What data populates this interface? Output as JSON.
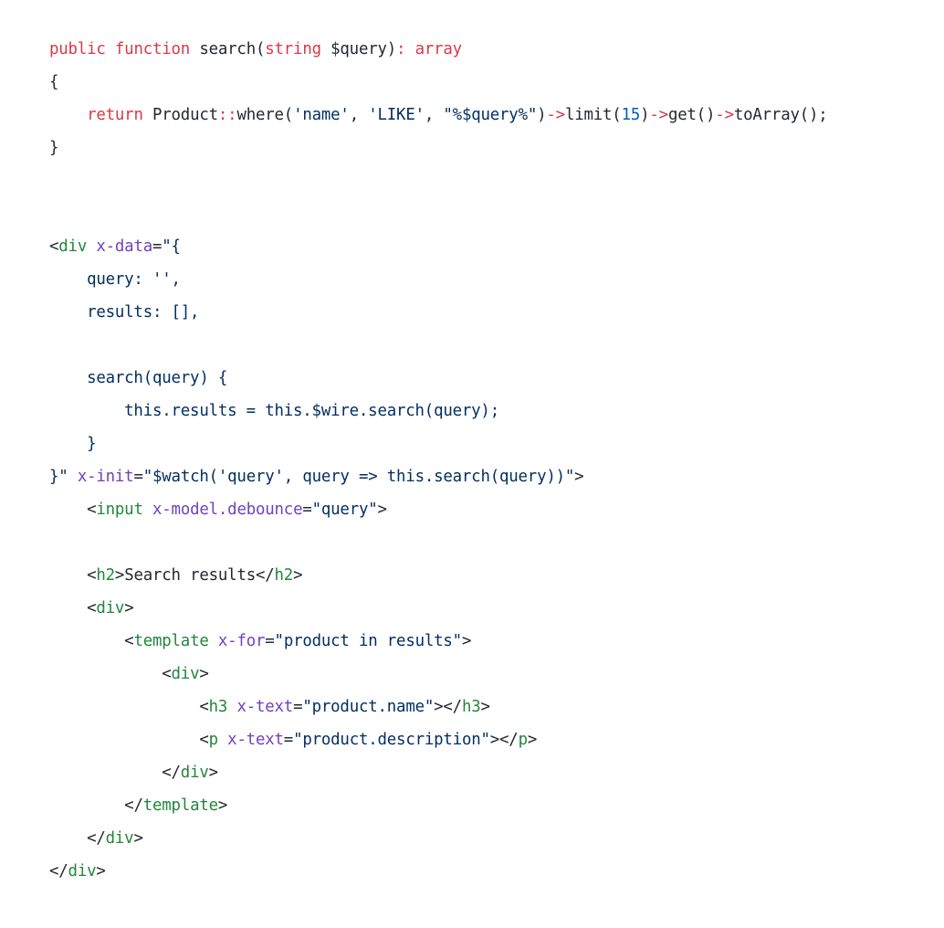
{
  "colors": {
    "background": "#ffffff",
    "keyword": "#d73a49",
    "plain": "#24292e",
    "string": "#032f62",
    "number": "#005cc5",
    "tag": "#22863a",
    "attribute": "#6f42c1"
  },
  "code": {
    "language_sections": [
      "php",
      "html-alpine"
    ],
    "lines": [
      [
        [
          "keyword",
          "public"
        ],
        [
          "plain",
          " "
        ],
        [
          "keyword",
          "function"
        ],
        [
          "plain",
          " search("
        ],
        [
          "keyword",
          "string"
        ],
        [
          "plain",
          " $query)"
        ],
        [
          "keyword",
          ": array"
        ]
      ],
      [
        [
          "plain",
          "{"
        ]
      ],
      [
        [
          "plain",
          "    "
        ],
        [
          "keyword",
          "return"
        ],
        [
          "plain",
          " Product"
        ],
        [
          "keyword",
          "::"
        ],
        [
          "plain",
          "where("
        ],
        [
          "string",
          "'name'"
        ],
        [
          "plain",
          ", "
        ],
        [
          "string",
          "'LIKE'"
        ],
        [
          "plain",
          ", "
        ],
        [
          "string",
          "\"%$query%\""
        ],
        [
          "plain",
          ")"
        ],
        [
          "keyword",
          "->"
        ],
        [
          "plain",
          "limit("
        ],
        [
          "number",
          "15"
        ],
        [
          "plain",
          ")"
        ],
        [
          "keyword",
          "->"
        ],
        [
          "plain",
          "get()"
        ],
        [
          "keyword",
          "->"
        ],
        [
          "plain",
          "toArray();"
        ]
      ],
      [
        [
          "plain",
          "}"
        ]
      ],
      [
        [
          "plain",
          ""
        ]
      ],
      [
        [
          "plain",
          ""
        ]
      ],
      [
        [
          "punct",
          "<"
        ],
        [
          "tag",
          "div"
        ],
        [
          "plain",
          " "
        ],
        [
          "attr",
          "x-data"
        ],
        [
          "punct",
          "="
        ],
        [
          "string",
          "\"{"
        ]
      ],
      [
        [
          "string",
          "    query: '',"
        ]
      ],
      [
        [
          "string",
          "    results: [],"
        ]
      ],
      [
        [
          "plain",
          ""
        ]
      ],
      [
        [
          "string",
          "    search(query) {"
        ]
      ],
      [
        [
          "string",
          "        this.results = this.$wire.search(query);"
        ]
      ],
      [
        [
          "string",
          "    }"
        ]
      ],
      [
        [
          "string",
          "}\""
        ],
        [
          "plain",
          " "
        ],
        [
          "attr",
          "x-init"
        ],
        [
          "punct",
          "="
        ],
        [
          "string",
          "\"$watch('query', query => this.search(query))\""
        ],
        [
          "punct",
          ">"
        ]
      ],
      [
        [
          "plain",
          "    "
        ],
        [
          "punct",
          "<"
        ],
        [
          "tag",
          "input"
        ],
        [
          "plain",
          " "
        ],
        [
          "attr",
          "x-model.debounce"
        ],
        [
          "punct",
          "="
        ],
        [
          "string",
          "\"query\""
        ],
        [
          "punct",
          ">"
        ]
      ],
      [
        [
          "plain",
          ""
        ]
      ],
      [
        [
          "plain",
          "    "
        ],
        [
          "punct",
          "<"
        ],
        [
          "tag",
          "h2"
        ],
        [
          "punct",
          ">"
        ],
        [
          "plain",
          "Search results"
        ],
        [
          "punct",
          "</"
        ],
        [
          "tag",
          "h2"
        ],
        [
          "punct",
          ">"
        ]
      ],
      [
        [
          "plain",
          "    "
        ],
        [
          "punct",
          "<"
        ],
        [
          "tag",
          "div"
        ],
        [
          "punct",
          ">"
        ]
      ],
      [
        [
          "plain",
          "        "
        ],
        [
          "punct",
          "<"
        ],
        [
          "tag",
          "template"
        ],
        [
          "plain",
          " "
        ],
        [
          "attr",
          "x-for"
        ],
        [
          "punct",
          "="
        ],
        [
          "string",
          "\"product in results\""
        ],
        [
          "punct",
          ">"
        ]
      ],
      [
        [
          "plain",
          "            "
        ],
        [
          "punct",
          "<"
        ],
        [
          "tag",
          "div"
        ],
        [
          "punct",
          ">"
        ]
      ],
      [
        [
          "plain",
          "                "
        ],
        [
          "punct",
          "<"
        ],
        [
          "tag",
          "h3"
        ],
        [
          "plain",
          " "
        ],
        [
          "attr",
          "x-text"
        ],
        [
          "punct",
          "="
        ],
        [
          "string",
          "\"product.name\""
        ],
        [
          "punct",
          "></"
        ],
        [
          "tag",
          "h3"
        ],
        [
          "punct",
          ">"
        ]
      ],
      [
        [
          "plain",
          "                "
        ],
        [
          "punct",
          "<"
        ],
        [
          "tag",
          "p"
        ],
        [
          "plain",
          " "
        ],
        [
          "attr",
          "x-text"
        ],
        [
          "punct",
          "="
        ],
        [
          "string",
          "\"product.description\""
        ],
        [
          "punct",
          "></"
        ],
        [
          "tag",
          "p"
        ],
        [
          "punct",
          ">"
        ]
      ],
      [
        [
          "plain",
          "            "
        ],
        [
          "punct",
          "</"
        ],
        [
          "tag",
          "div"
        ],
        [
          "punct",
          ">"
        ]
      ],
      [
        [
          "plain",
          "        "
        ],
        [
          "punct",
          "</"
        ],
        [
          "tag",
          "template"
        ],
        [
          "punct",
          ">"
        ]
      ],
      [
        [
          "plain",
          "    "
        ],
        [
          "punct",
          "</"
        ],
        [
          "tag",
          "div"
        ],
        [
          "punct",
          ">"
        ]
      ],
      [
        [
          "punct",
          "</"
        ],
        [
          "tag",
          "div"
        ],
        [
          "punct",
          ">"
        ]
      ]
    ]
  }
}
